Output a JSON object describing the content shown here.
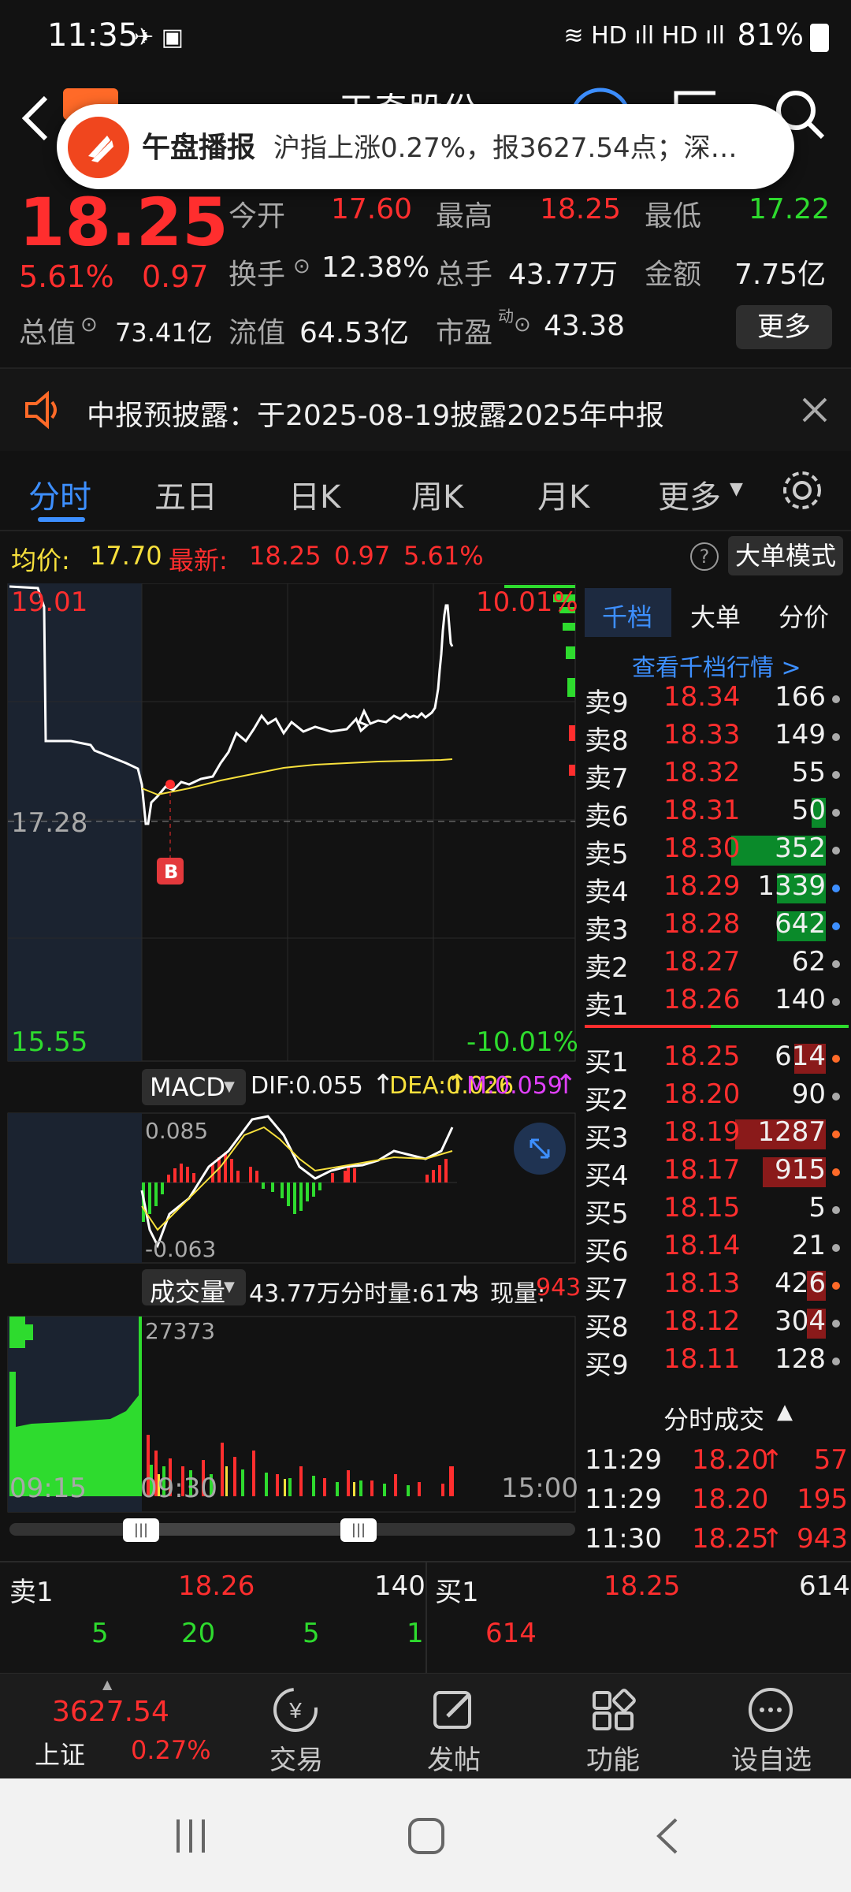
{
  "status_bar": {
    "time": "11:35",
    "battery": "81%"
  },
  "header": {
    "stock_name": "天奇股份",
    "back_label": "<"
  },
  "notification": {
    "title": "午盘播报",
    "text": "沪指上涨0.27%，报3627.54点；深…"
  },
  "quote": {
    "price": "18.25",
    "change_pct": "5.61%",
    "change": "0.97",
    "open_label": "今开",
    "open": "17.60",
    "high_label": "最高",
    "high": "18.25",
    "low_label": "最低",
    "low": "17.22",
    "turnover_label": "换手",
    "turnover": "12.38%",
    "volume_label": "总手",
    "volume": "43.77万",
    "amount_label": "金额",
    "amount": "7.75亿",
    "mktcap_label": "总值",
    "mktcap": "73.41亿",
    "float_label": "流值",
    "float_cap": "64.53亿",
    "pe_label": "市盈",
    "pe_sup": "动",
    "pe": "43.38",
    "more_button": "更多"
  },
  "announcement": {
    "text": "中报预披露：于2025-08-19披露2025年中报"
  },
  "tabs": [
    "分时",
    "五日",
    "日K",
    "周K",
    "月K",
    "更多"
  ],
  "active_tab": "分时",
  "info_row": {
    "avg_label": "均价:",
    "avg": "17.70",
    "latest_label": "最新:",
    "latest": "18.25",
    "change": "0.97",
    "change_pct": "5.61%",
    "mode_button": "大单模式"
  },
  "chart": {
    "y_top": "19.01",
    "y_bottom": "15.55",
    "y_mid": "17.28",
    "pct_top": "10.01%",
    "pct_bottom": "-10.01%",
    "marker": "B",
    "macd_button": "MACD",
    "dif": "DIF:0.055",
    "dea": "DEA:0.026",
    "m": "M:0.059",
    "macd_top": "0.085",
    "macd_bottom": "-0.063",
    "vol_button": "成交量",
    "vol_total": "43.77万",
    "vol_tick_label": "分时量:6173",
    "vol_now_label": "现量:",
    "vol_now": "943",
    "vol_max": "27373",
    "time_start": "09:15",
    "time_mid": "09:30",
    "time_end": "15:00"
  },
  "side_tabs": [
    "千档",
    "大单",
    "分价"
  ],
  "side_link": "查看千档行情 >",
  "asks": [
    {
      "label": "卖9",
      "price": "18.34",
      "vol": "166"
    },
    {
      "label": "卖8",
      "price": "18.33",
      "vol": "149"
    },
    {
      "label": "卖7",
      "price": "18.32",
      "vol": "55"
    },
    {
      "label": "卖6",
      "price": "18.31",
      "vol": "50"
    },
    {
      "label": "卖5",
      "price": "18.30",
      "vol": "352"
    },
    {
      "label": "卖4",
      "price": "18.29",
      "vol": "1339"
    },
    {
      "label": "卖3",
      "price": "18.28",
      "vol": "642"
    },
    {
      "label": "卖2",
      "price": "18.27",
      "vol": "62"
    },
    {
      "label": "卖1",
      "price": "18.26",
      "vol": "140"
    }
  ],
  "bids": [
    {
      "label": "买1",
      "price": "18.25",
      "vol": "614"
    },
    {
      "label": "买2",
      "price": "18.20",
      "vol": "90"
    },
    {
      "label": "买3",
      "price": "18.19",
      "vol": "1287"
    },
    {
      "label": "买4",
      "price": "18.17",
      "vol": "915"
    },
    {
      "label": "买5",
      "price": "18.15",
      "vol": "5"
    },
    {
      "label": "买6",
      "price": "18.14",
      "vol": "21"
    },
    {
      "label": "买7",
      "price": "18.13",
      "vol": "426"
    },
    {
      "label": "买8",
      "price": "18.12",
      "vol": "304"
    },
    {
      "label": "买9",
      "price": "18.11",
      "vol": "128"
    }
  ],
  "ticks_title": "分时成交",
  "ticks": [
    {
      "time": "11:29",
      "price": "18.20",
      "arrow": "↑",
      "vol": "57"
    },
    {
      "time": "11:29",
      "price": "18.20",
      "arrow": "",
      "vol": "195"
    },
    {
      "time": "11:30",
      "price": "18.25",
      "arrow": "↑",
      "vol": "943"
    }
  ],
  "queue": {
    "ask_label": "卖1",
    "ask_price": "18.26",
    "ask_vol": "140",
    "bid_label": "买1",
    "bid_price": "18.25",
    "bid_vol": "614",
    "ask_orders": [
      "5",
      "20",
      "5",
      "1"
    ],
    "bid_orders": [
      "614"
    ]
  },
  "bottom_nav": {
    "index_value": "3627.54",
    "index_name": "上证",
    "index_pct": "0.27%",
    "trade": "交易",
    "post": "发帖",
    "function": "功能",
    "watchlist": "设自选"
  },
  "colors": {
    "up": "#ff2e2e",
    "down": "#2edb2e",
    "accent": "#3d8fff",
    "background": "#121212"
  }
}
